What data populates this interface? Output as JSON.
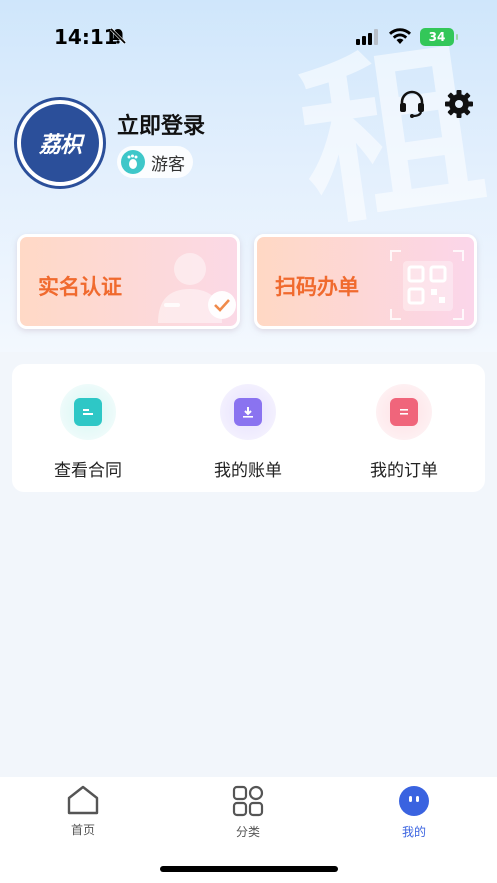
{
  "status_bar": {
    "time": "14:11",
    "battery": "34"
  },
  "hero": {
    "watermark": "租"
  },
  "profile": {
    "avatar_text": "荔枳",
    "login_title": "立即登录",
    "guest_label": "游客"
  },
  "cards": {
    "verify": {
      "label": "实名认证"
    },
    "scan": {
      "label": "扫码办单"
    }
  },
  "quick_actions": [
    {
      "label": "查看合同",
      "color": "#2ec7c6"
    },
    {
      "label": "我的账单",
      "color": "#8a73f0"
    },
    {
      "label": "我的订单",
      "color": "#f0657b"
    }
  ],
  "tabbar": {
    "items": [
      {
        "label": "首页"
      },
      {
        "label": "分类"
      },
      {
        "label": "我的"
      }
    ],
    "active_color": "#3a63e0"
  }
}
